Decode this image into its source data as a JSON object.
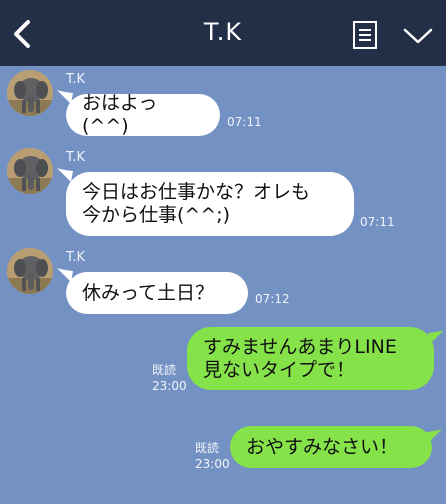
{
  "header": {
    "title": "T.K",
    "icons": {
      "back": "chevron-left-icon",
      "note": "note-icon",
      "menu": "chevron-down-icon"
    }
  },
  "colors": {
    "header_bg": "#232e47",
    "chat_bg": "#7391c3",
    "incoming_bubble": "#ffffff",
    "outgoing_bubble": "#85e249"
  },
  "messages": [
    {
      "direction": "incoming",
      "sender": "T.K",
      "lines": [
        "おはよっ(^^)"
      ],
      "time": "07:11"
    },
    {
      "direction": "incoming",
      "sender": "T.K",
      "lines": [
        "今日はお仕事かな？オレも",
        "今から仕事(^^;)"
      ],
      "time": "07:11"
    },
    {
      "direction": "incoming",
      "sender": "T.K",
      "lines": [
        "休みって土日？"
      ],
      "time": "07:12"
    },
    {
      "direction": "outgoing",
      "lines": [
        "すみませんあまりLINE",
        "見ないタイプで！"
      ],
      "read": "既読",
      "time": "23:00"
    },
    {
      "direction": "outgoing",
      "lines": [
        "おやすみなさい！"
      ],
      "read": "既読",
      "time": "23:00"
    }
  ]
}
